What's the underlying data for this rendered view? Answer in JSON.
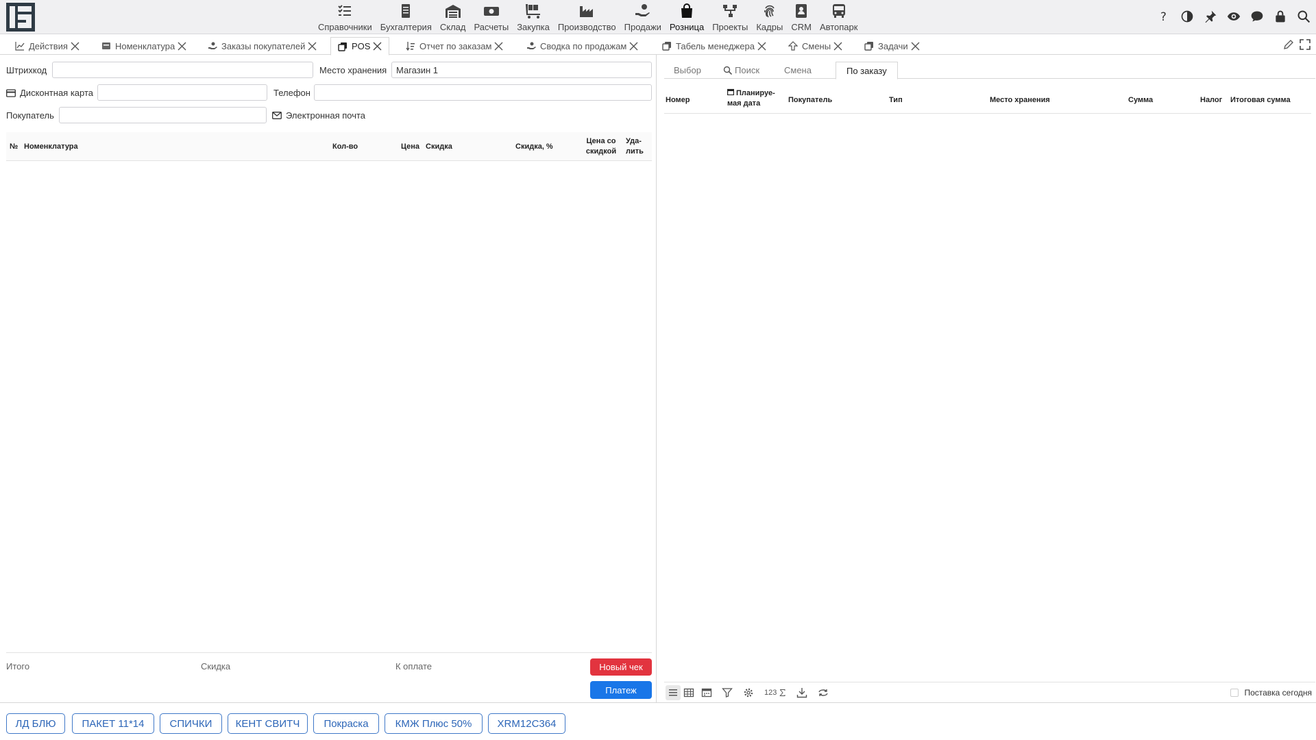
{
  "topnav": {
    "items": [
      {
        "label": "Справочники",
        "icon": "checklist-icon"
      },
      {
        "label": "Бухгалтерия",
        "icon": "ledger-icon"
      },
      {
        "label": "Склад",
        "icon": "warehouse-icon"
      },
      {
        "label": "Расчеты",
        "icon": "cash-icon"
      },
      {
        "label": "Закупка",
        "icon": "cart-icon"
      },
      {
        "label": "Производство",
        "icon": "factory-icon"
      },
      {
        "label": "Продажи",
        "icon": "hand-coin-icon"
      },
      {
        "label": "Розница",
        "icon": "shopping-bag-icon"
      },
      {
        "label": "Проекты",
        "icon": "diagram-icon"
      },
      {
        "label": "Кадры",
        "icon": "fingerprint-icon"
      },
      {
        "label": "CRM",
        "icon": "contact-card-icon"
      },
      {
        "label": "Автопарк",
        "icon": "bus-icon"
      }
    ],
    "active": "Розница"
  },
  "tabs": [
    {
      "label": "Действия",
      "icon": "chart-line-icon"
    },
    {
      "label": "Номенклатура",
      "icon": "tag-icon"
    },
    {
      "label": "Заказы покупателей",
      "icon": "hand-icon"
    },
    {
      "label": "POS",
      "icon": "copy-icon",
      "active": true
    },
    {
      "label": "Отчет по заказам",
      "icon": "sort-icon"
    },
    {
      "label": "Сводка по продажам",
      "icon": "hand-icon"
    },
    {
      "label": "Табель менеджера",
      "icon": "copy-icon"
    },
    {
      "label": "Смены",
      "icon": "arrow-icon"
    },
    {
      "label": "Задачи",
      "icon": "copy-icon"
    }
  ],
  "pos": {
    "barcode_label": "Штрихкод",
    "barcode_value": "",
    "storage_label": "Место хранения",
    "storage_value": "Магазин 1",
    "card_label": "Дисконтная карта",
    "card_value": "",
    "phone_label": "Телефон",
    "phone_value": "",
    "buyer_label": "Покупатель",
    "buyer_value": "",
    "email_label": "Электронная почта",
    "columns": {
      "num": "№",
      "item": "Номенклатура",
      "qty": "Кол-во",
      "price": "Цена",
      "discount": "Скидка",
      "discount_pct": "Скидка, %",
      "price_disc_1": "Цена со",
      "price_disc_2": "скидкой",
      "delete_1": "Уда-",
      "delete_2": "лить"
    },
    "total_label": "Итого",
    "discount_label": "Скидка",
    "topay_label": "К оплате",
    "new_check": "Новый чек",
    "payment": "Платеж"
  },
  "right": {
    "subtabs": [
      "Выбор",
      "Поиск",
      "Смена",
      "По заказу"
    ],
    "active_subtab": "По заказу",
    "columns": {
      "number": "Номер",
      "planned_1": "Планируе-",
      "planned_2": "мая дата",
      "buyer": "Покупатель",
      "type": "Тип",
      "storage": "Место хранения",
      "sum": "Сумма",
      "tax": "Налог",
      "total": "Итоговая сумма"
    },
    "counter": "123",
    "delivery_today": "Поставка сегодня"
  },
  "quick_buttons": [
    "ЛД БЛЮ",
    "ПАКЕТ 11*14",
    "СПИЧКИ",
    "КЕНТ СВИТЧ",
    "Покраска",
    "КМЖ Плюс 50%",
    "XRM12C364"
  ],
  "colors": {
    "red": "#e2343f",
    "blue": "#1976e8",
    "quick": "#3f78c8"
  }
}
